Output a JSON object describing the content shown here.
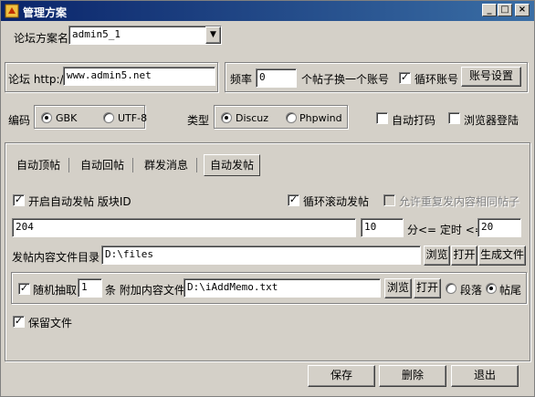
{
  "window": {
    "title": "管理方案",
    "minimize_glyph": "_",
    "maximize_glyph": "□",
    "close_glyph": "×"
  },
  "scheme": {
    "label": "论坛方案名",
    "value": "admin5_1",
    "dropdown_glyph": "▼"
  },
  "forum": {
    "url_label": "论坛 http://",
    "url_value": "www.admin5.net",
    "rate_label": "频率",
    "rate_value": "0",
    "rate_suffix": "个帖子换一个账号",
    "loop_account_label": "循环账号",
    "loop_account_checked": true,
    "account_settings_button": "账号设置"
  },
  "encoding": {
    "label": "编码",
    "options": [
      "GBK",
      "UTF-8"
    ],
    "selected": "GBK"
  },
  "type": {
    "label": "类型",
    "options": [
      "Discuz",
      "Phpwind"
    ],
    "selected": "Discuz"
  },
  "options": {
    "auto_captcha_label": "自动打码",
    "auto_captcha_checked": false,
    "browser_login_label": "浏览器登陆",
    "browser_login_checked": false
  },
  "tabs": [
    {
      "label": "自动顶帖",
      "active": false
    },
    {
      "label": "自动回帖",
      "active": false
    },
    {
      "label": "群发消息",
      "active": false
    },
    {
      "label": "自动发帖",
      "active": true
    }
  ],
  "auto_post": {
    "enable_label": "开启自动发帖  版块ID",
    "enable_checked": true,
    "loop_scroll_label": "循环滚动发帖",
    "loop_scroll_checked": true,
    "allow_repeat_label": "允许重复发内容相同帖子",
    "allow_repeat_checked": false,
    "board_id_value": "204",
    "timer_min_value": "10",
    "timer_label": "分<= 定时  <=",
    "timer_max_value": "20",
    "content_dir_label": "发帖内容文件目录",
    "content_dir_value": "D:\\files",
    "browse_button": "浏览",
    "open_button": "打开",
    "generate_button": "生成文件",
    "random_label": "随机抽取",
    "random_checked": true,
    "random_count_value": "1",
    "attach_label": "条 附加内容文件",
    "attach_value": "D:\\iAddMemo.txt",
    "attach_browse_button": "浏览",
    "attach_open_button": "打开",
    "position_options": [
      "段落",
      "帖尾"
    ],
    "position_selected": "帖尾",
    "keep_file_label": "保留文件",
    "keep_file_checked": true
  },
  "footer": {
    "save_button": "保存",
    "delete_button": "删除",
    "exit_button": "退出"
  }
}
